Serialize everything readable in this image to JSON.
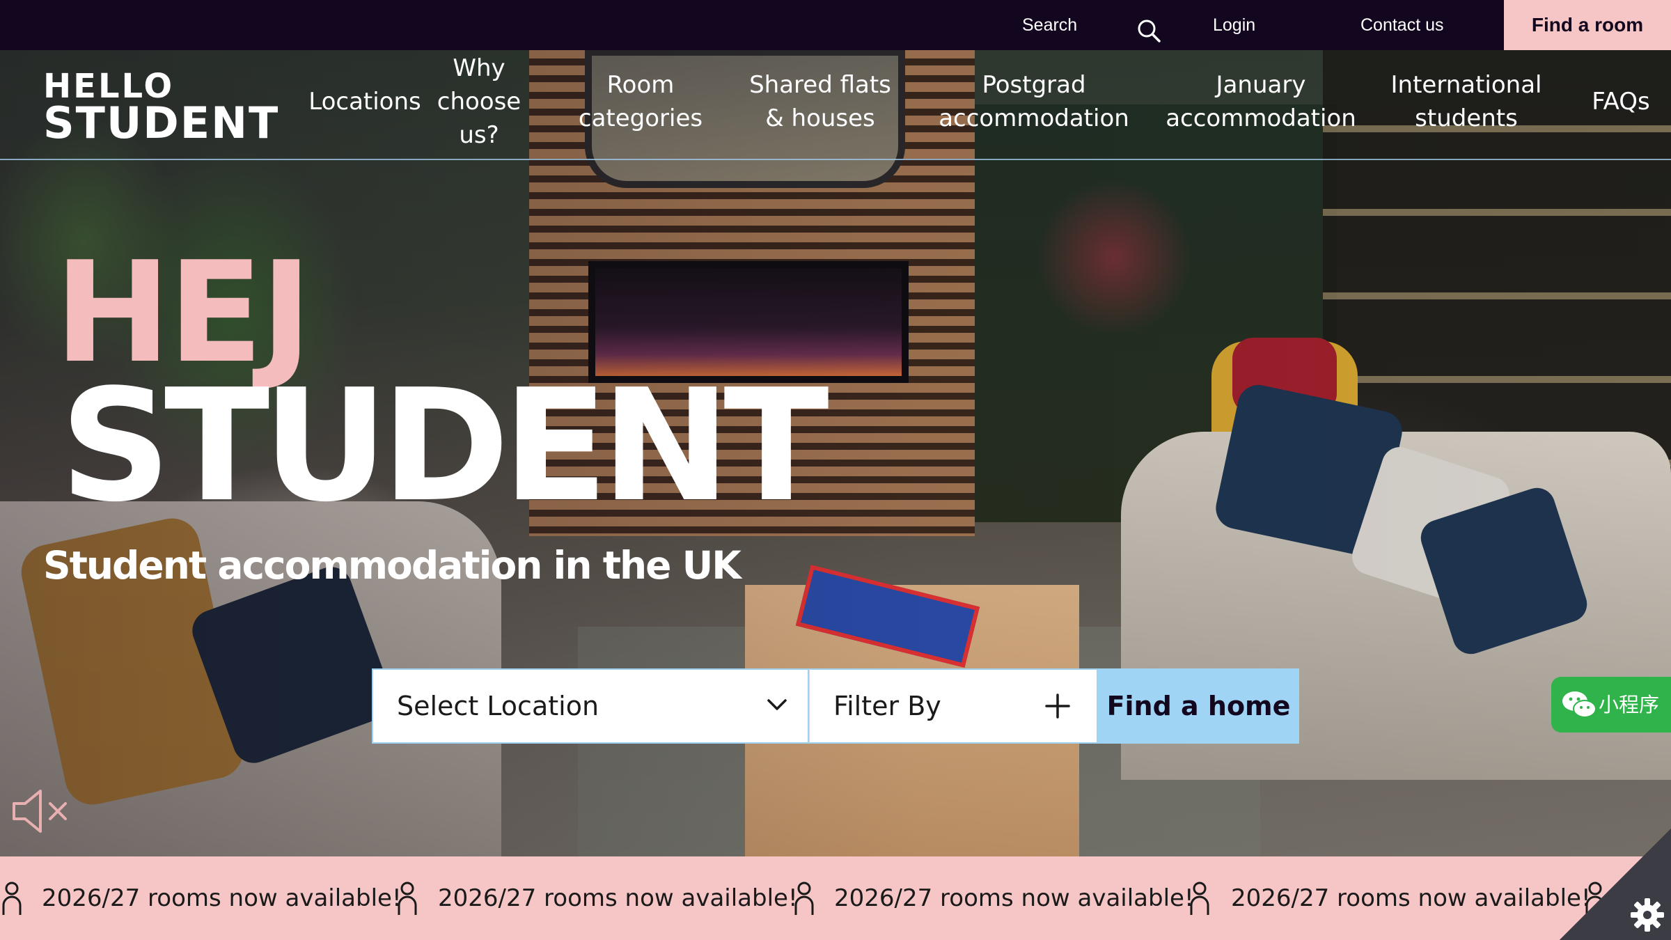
{
  "topbar": {
    "search_label": "Search",
    "login_label": "Login",
    "contact_label": "Contact us",
    "find_room_label": "Find a room"
  },
  "brand": {
    "logo_line1": "HELLO",
    "logo_line2": "STUDENT"
  },
  "nav": {
    "items": [
      {
        "label": "Locations"
      },
      {
        "label": "Why\nchoose\nus?"
      },
      {
        "label": "Room\ncategories"
      },
      {
        "label": "Shared flats\n& houses"
      },
      {
        "label": "Postgrad\naccommodation"
      },
      {
        "label": "January\naccommodation"
      },
      {
        "label": "International\nstudents"
      },
      {
        "label": "FAQs"
      }
    ]
  },
  "hero": {
    "greeting": "HEJ",
    "headline": "STUDENT",
    "subheading": "Student accommodation in the UK"
  },
  "search": {
    "location_select_value": "Select Location",
    "filter_label": "Filter By",
    "submit_label": "Find a home"
  },
  "wechat": {
    "label": "小程序"
  },
  "ticker": {
    "message": "2026/27 rooms now available!"
  },
  "colors": {
    "topbar_bg": "#12071f",
    "accent_pink": "#f6c5c5",
    "accent_blue": "#9fd4f4",
    "wechat_green": "#2fb34a"
  },
  "icons": {
    "search": "search-icon",
    "chevron": "chevron-down-icon",
    "plus": "plus-icon",
    "mute": "mute-icon",
    "ticker": "person-icon",
    "settings": "gear-icon",
    "wechat": "wechat-icon"
  }
}
